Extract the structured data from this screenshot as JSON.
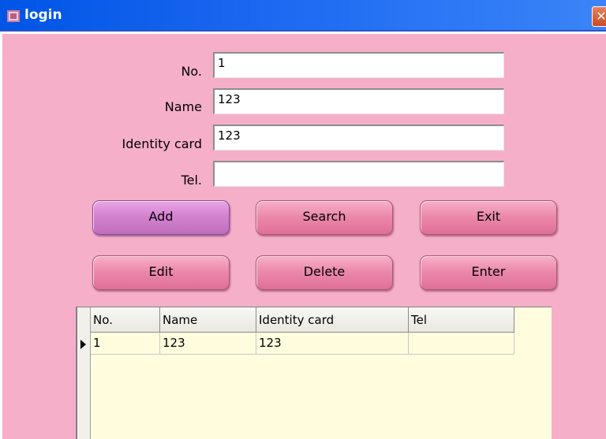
{
  "window": {
    "title": "login",
    "close_glyph": "✕",
    "icon": "app-icon"
  },
  "form": {
    "no_label": "No.",
    "no_value": "1",
    "name_label": "Name",
    "name_value": "123",
    "identity_label": "Identity card",
    "identity_value": "123",
    "tel_label": "Tel.",
    "tel_value": ""
  },
  "buttons": {
    "add": "Add",
    "search": "Search",
    "exit": "Exit",
    "edit": "Edit",
    "delete": "Delete",
    "enter": "Enter"
  },
  "grid": {
    "columns": [
      "No.",
      "Name",
      "Identity card",
      "Tel"
    ],
    "rows": [
      [
        "1",
        "123",
        "123",
        ""
      ]
    ]
  },
  "colors": {
    "background": "#f6afc8",
    "titlebar": "#0055e5",
    "button": "#ec8aab",
    "button_active": "#d383cf",
    "grid_background": "#fffdde"
  }
}
